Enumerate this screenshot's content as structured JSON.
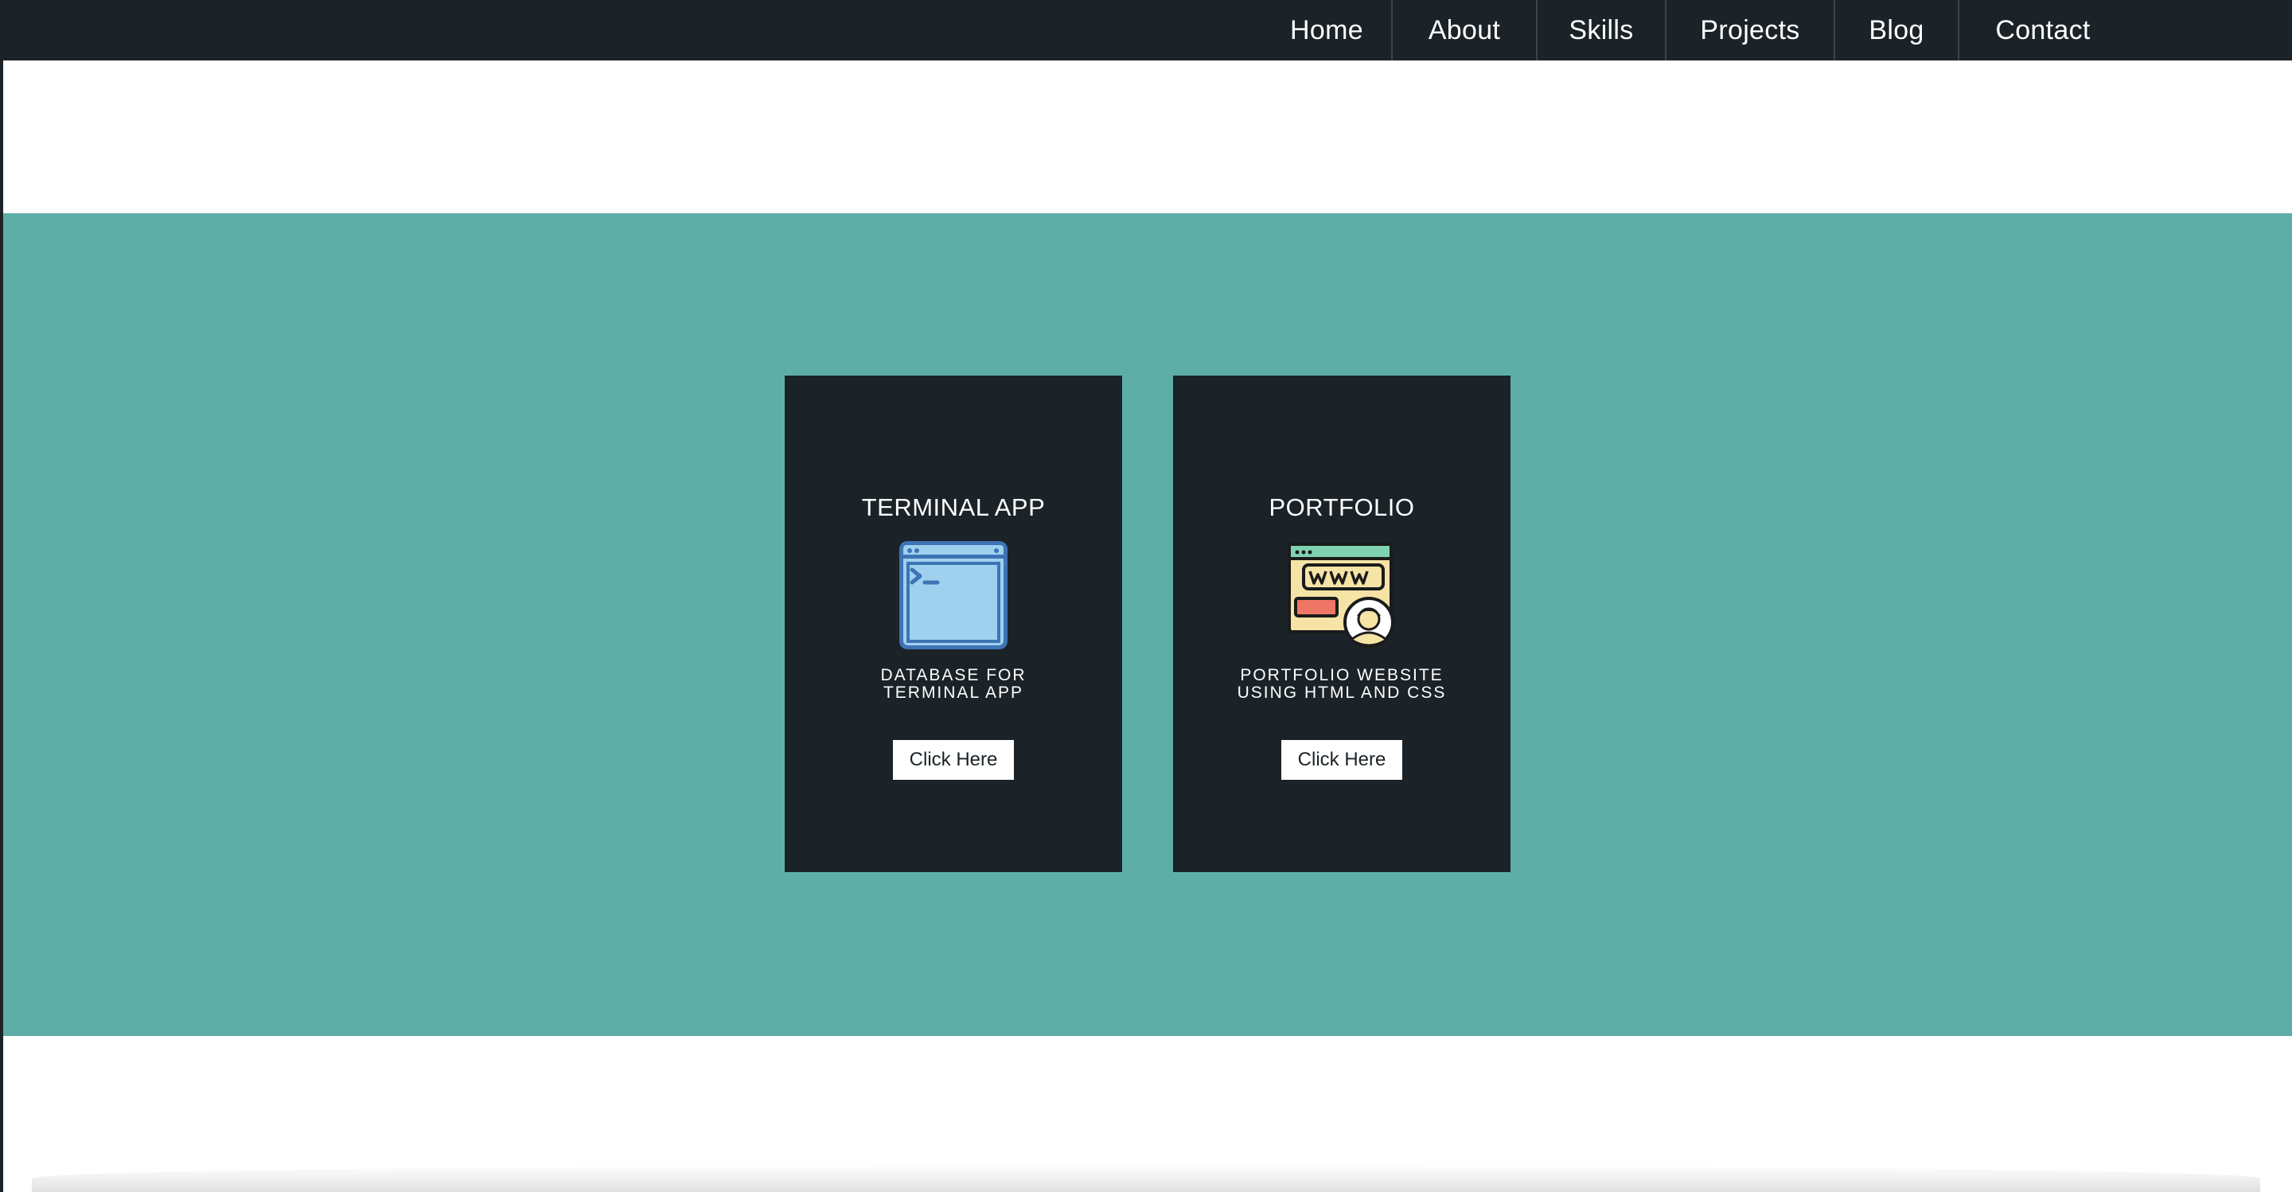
{
  "nav": {
    "items": [
      {
        "label": "Home"
      },
      {
        "label": "About"
      },
      {
        "label": "Skills"
      },
      {
        "label": "Projects"
      },
      {
        "label": "Blog"
      },
      {
        "label": "Contact"
      }
    ]
  },
  "projects": [
    {
      "title": "TERMINAL APP",
      "icon": "terminal-window-icon",
      "description": "DATABASE FOR\nTERMINAL APP",
      "button_label": "Click Here"
    },
    {
      "title": "PORTFOLIO",
      "icon": "website-portfolio-icon",
      "description": "PORTFOLIO WEBSITE\nUSING HTML AND CSS",
      "button_label": "Click Here"
    }
  ],
  "colors": {
    "nav_background": "#1b2328",
    "section_background": "#5eaea8",
    "card_background": "#1b2328",
    "button_background": "#ffffff"
  }
}
